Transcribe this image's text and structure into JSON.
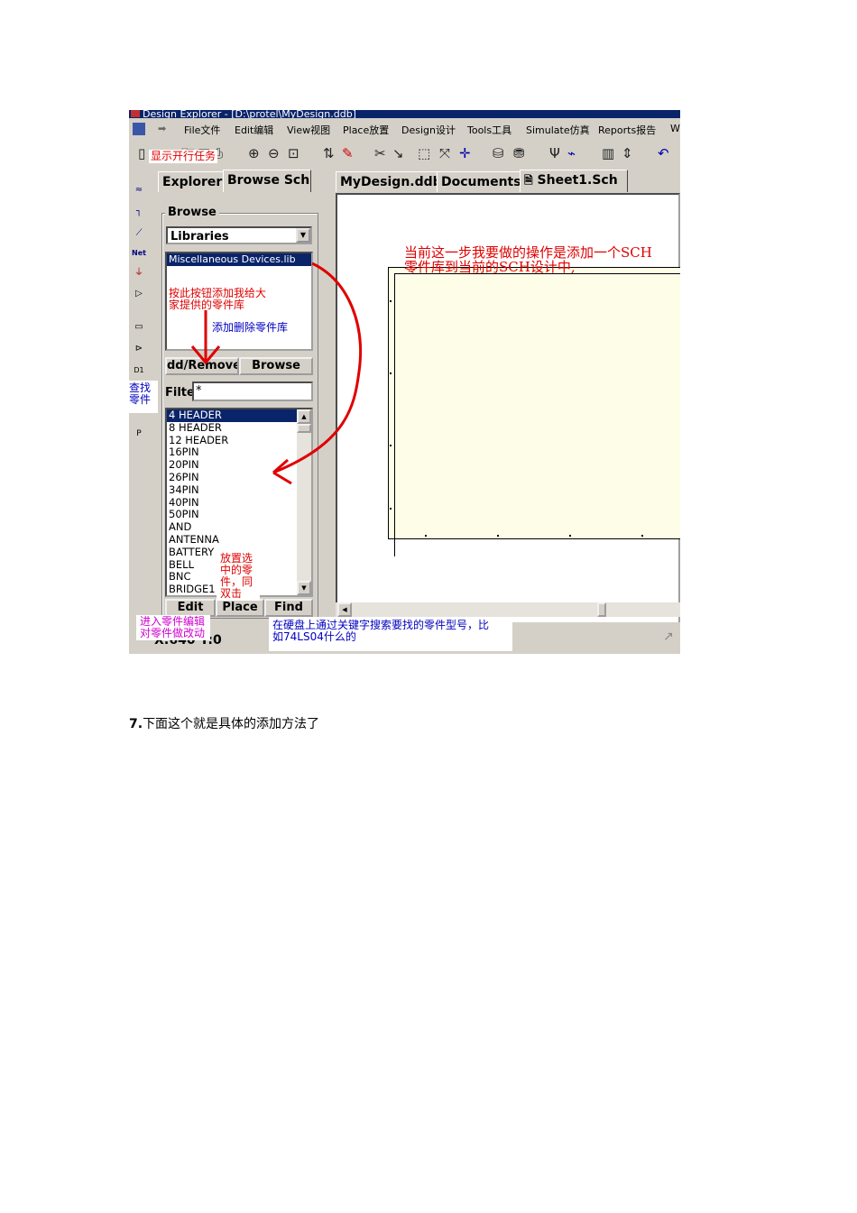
{
  "window": {
    "title": "Design Explorer - [D:\\protel\\MyDesign.ddb]"
  },
  "menu": [
    "File文件",
    "Edit编辑",
    "View视图",
    "Place放置",
    "Design设计",
    "Tools工具",
    "Simulate仿真",
    "Reports报告",
    "W"
  ],
  "explorer_tabs": [
    "Explorer",
    "Browse Sch"
  ],
  "browse": {
    "title": "Browse",
    "combo_value": "Libraries",
    "libraries": [
      "Miscellaneous Devices.lib"
    ],
    "add_remove_label": "dd/Remove",
    "browse_label": "Browse",
    "filter_label": "Filte",
    "filter_value": "*",
    "parts": [
      "4 HEADER",
      "8 HEADER",
      "12 HEADER",
      "16PIN",
      "20PIN",
      "26PIN",
      "34PIN",
      "40PIN",
      "50PIN",
      "AND",
      "ANTENNA",
      "BATTERY",
      "BELL",
      "BNC",
      "BRIDGE1"
    ],
    "edit_label": "Edit",
    "place_label": "Place",
    "find_label": "Find"
  },
  "doc_tabs": [
    "MyDesign.ddb",
    "Documents",
    "Sheet1.Sch"
  ],
  "status": {
    "coord": "X:640 Y:0"
  },
  "annotations": {
    "show_tasks": "显示开行任务",
    "current_step_1": "当前这一步我要做的操作是添加一个SCH",
    "current_step_2": "零件库到当前的SCH设计中,",
    "press_button_1": "按此按钮添加我给大",
    "press_button_2": "家提供的零件库",
    "add_delete": "添加删除零件库",
    "find_part_1": "查找",
    "find_part_2": "零件",
    "place_1": "放置选",
    "place_2": "中的零",
    "place_3": "件，同",
    "place_4": "双击",
    "edit_1": "进入零件编辑",
    "edit_2": "对零件做改动",
    "search_1": "在硬盘上通过关键字搜索要找的零件型号，比",
    "search_2": "如74LS04什么的"
  },
  "caption": {
    "number": "7.",
    "text": "下面这个就是具体的添加方法了"
  }
}
